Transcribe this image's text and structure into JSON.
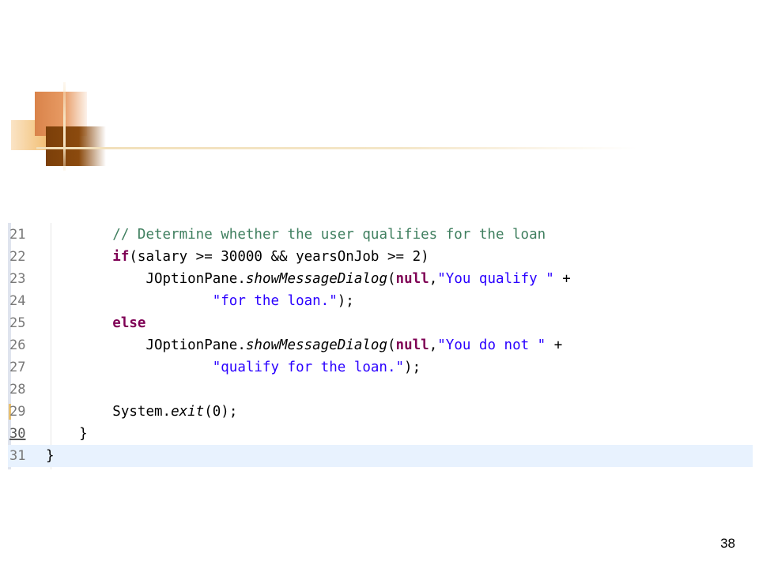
{
  "slide": {
    "page_number": "38"
  },
  "editor": {
    "lines": [
      {
        "no": "21",
        "indent": "        ",
        "parts": [
          {
            "t": "// Determine whether the user qualifies for the loan",
            "c": "cm"
          }
        ]
      },
      {
        "no": "22",
        "indent": "        ",
        "parts": [
          {
            "t": "if",
            "c": "kw"
          },
          {
            "t": "(salary >= 30000 && yearsOnJob >= 2)",
            "c": ""
          }
        ]
      },
      {
        "no": "23",
        "indent": "            ",
        "parts": [
          {
            "t": "JOptionPane.",
            "c": ""
          },
          {
            "t": "showMessageDialog",
            "c": "it"
          },
          {
            "t": "(",
            "c": ""
          },
          {
            "t": "null",
            "c": "kw"
          },
          {
            "t": ",",
            "c": ""
          },
          {
            "t": "\"You qualify \"",
            "c": "str"
          },
          {
            "t": " +",
            "c": ""
          }
        ]
      },
      {
        "no": "24",
        "indent": "                    ",
        "parts": [
          {
            "t": "\"for the loan.\"",
            "c": "str"
          },
          {
            "t": ");",
            "c": ""
          }
        ]
      },
      {
        "no": "25",
        "indent": "        ",
        "parts": [
          {
            "t": "else",
            "c": "kw"
          }
        ]
      },
      {
        "no": "26",
        "indent": "            ",
        "parts": [
          {
            "t": "JOptionPane.",
            "c": ""
          },
          {
            "t": "showMessageDialog",
            "c": "it"
          },
          {
            "t": "(",
            "c": ""
          },
          {
            "t": "null",
            "c": "kw"
          },
          {
            "t": ",",
            "c": ""
          },
          {
            "t": "\"You do not \"",
            "c": "str"
          },
          {
            "t": " +",
            "c": ""
          }
        ]
      },
      {
        "no": "27",
        "indent": "                    ",
        "parts": [
          {
            "t": "\"qualify for the loan.\"",
            "c": "str"
          },
          {
            "t": ");",
            "c": ""
          }
        ]
      },
      {
        "no": "28",
        "indent": "",
        "parts": []
      },
      {
        "no": "29",
        "indent": "        ",
        "parts": [
          {
            "t": "System.",
            "c": ""
          },
          {
            "t": "exit",
            "c": "it"
          },
          {
            "t": "(0);",
            "c": ""
          }
        ]
      },
      {
        "no": "30",
        "indent": "    ",
        "parts": [
          {
            "t": "}",
            "c": ""
          }
        ]
      },
      {
        "no": "31",
        "indent": "",
        "parts": [
          {
            "t": "}",
            "c": ""
          }
        ]
      }
    ],
    "current_line": "31",
    "marked_line": "29",
    "colors": {
      "comment": "#3f7f5f",
      "keyword": "#7f0055",
      "string": "#2a00ff",
      "current_line_bg": "#e8f2fe"
    }
  }
}
